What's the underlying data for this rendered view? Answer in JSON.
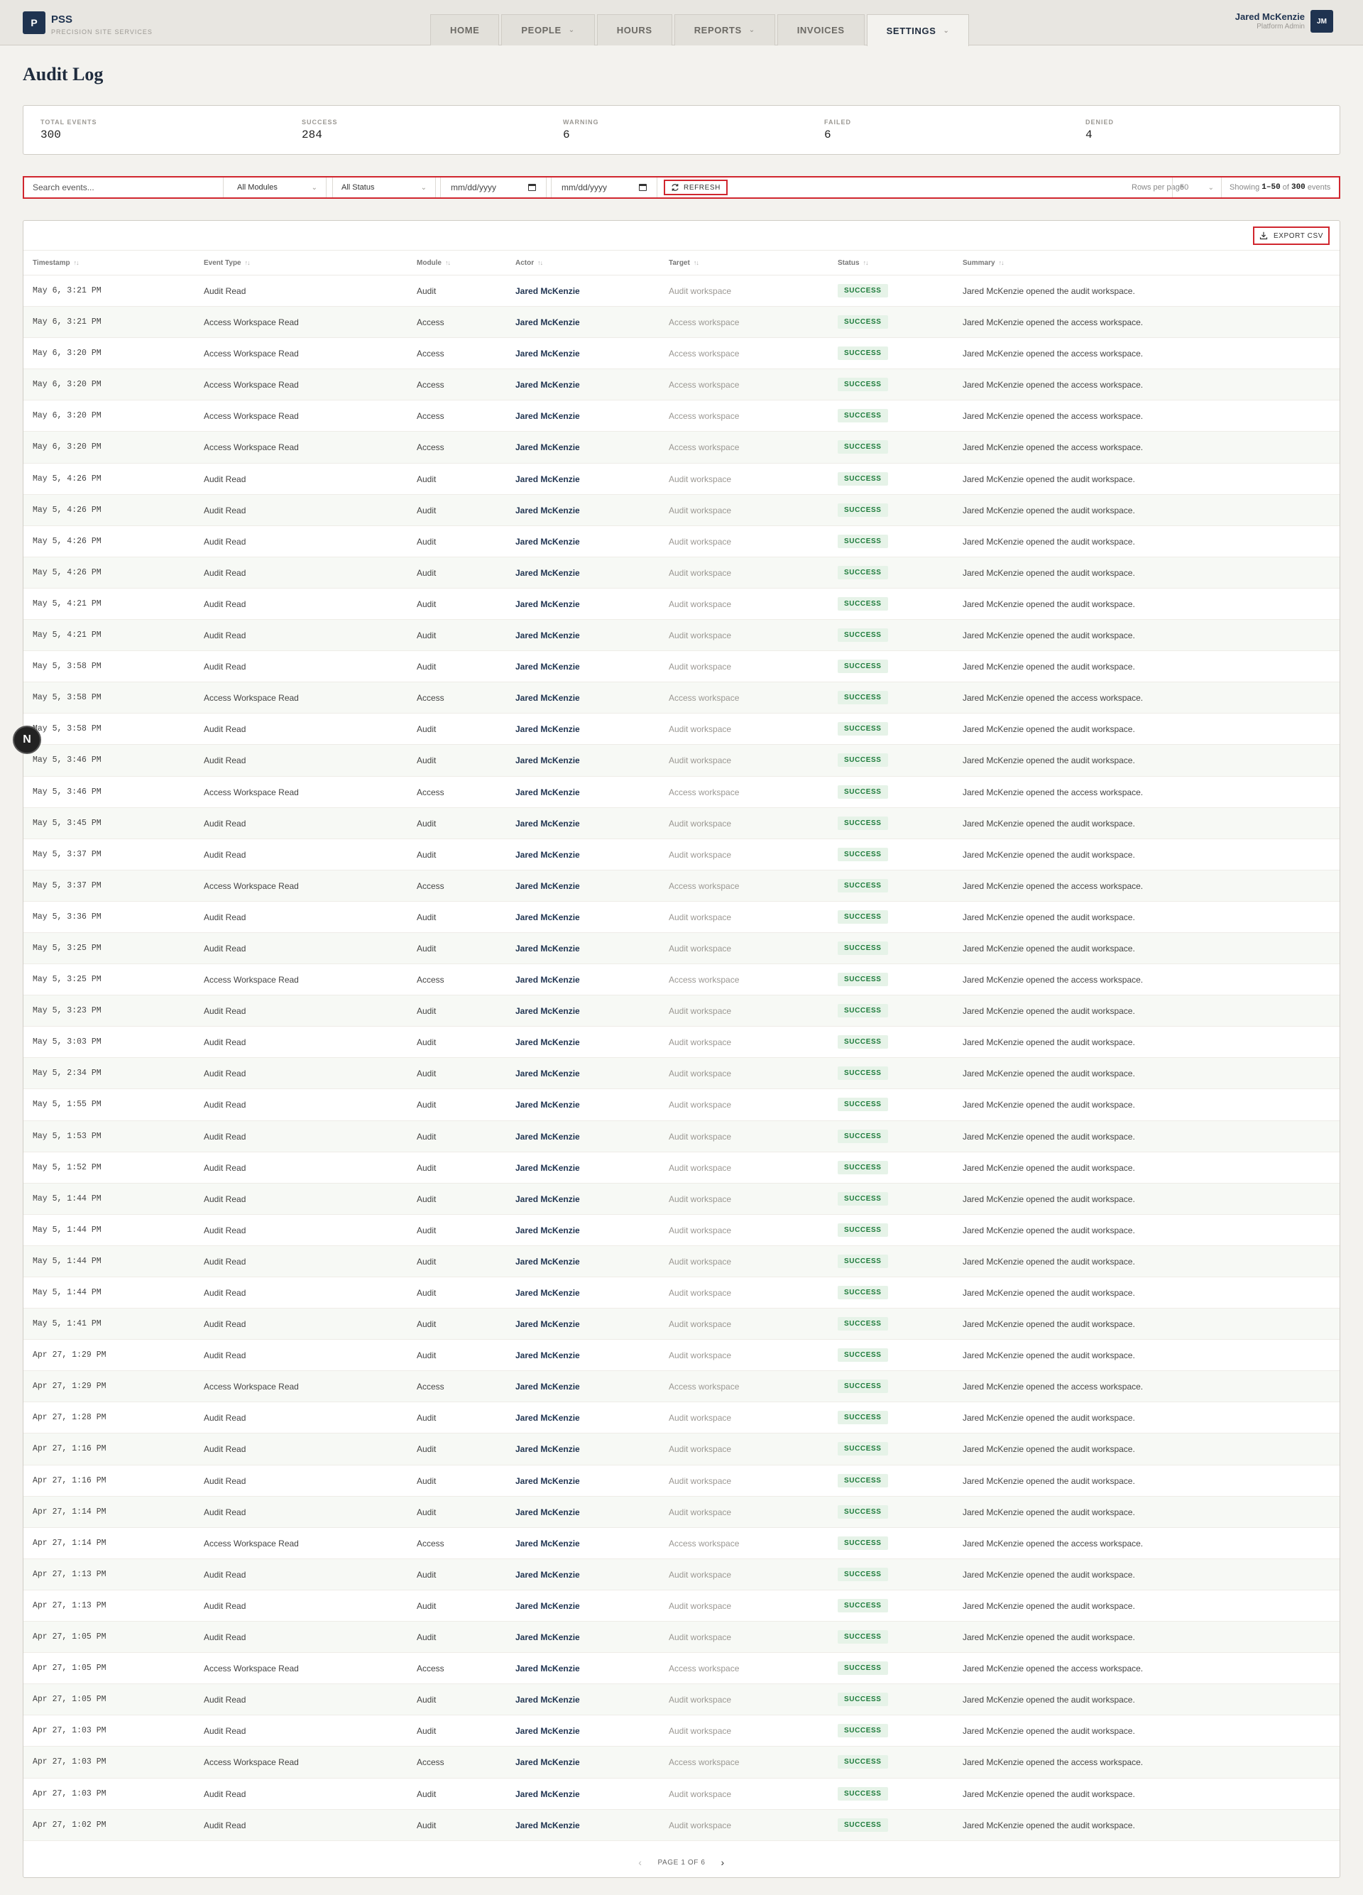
{
  "brand": {
    "logo": "P",
    "name": "PSS",
    "subtitle": "PRECISION SITE SERVICES"
  },
  "nav": {
    "tabs": [
      {
        "label": "HOME",
        "dropdown": false,
        "active": false
      },
      {
        "label": "PEOPLE",
        "dropdown": true,
        "active": false
      },
      {
        "label": "HOURS",
        "dropdown": false,
        "active": false
      },
      {
        "label": "REPORTS",
        "dropdown": true,
        "active": false
      },
      {
        "label": "INVOICES",
        "dropdown": false,
        "active": false
      },
      {
        "label": "SETTINGS",
        "dropdown": true,
        "active": true
      }
    ]
  },
  "user": {
    "name": "Jared McKenzie",
    "role": "Platform Admin",
    "initials": "JM"
  },
  "page": {
    "title": "Audit Log"
  },
  "summary": {
    "total": {
      "label": "TOTAL EVENTS",
      "value": "300"
    },
    "success": {
      "label": "SUCCESS",
      "value": "284"
    },
    "warning": {
      "label": "WARNING",
      "value": "6"
    },
    "failed": {
      "label": "FAILED",
      "value": "6"
    },
    "denied": {
      "label": "DENIED",
      "value": "4"
    }
  },
  "filters": {
    "search_placeholder": "Search events...",
    "module": "All Modules",
    "status": "All Status",
    "date_from": "mm/dd/yyyy",
    "date_to": "mm/dd/yyyy",
    "refresh_label": "REFRESH",
    "rows_label": "Rows per page",
    "rows_value": "50",
    "showing_prefix": "Showing",
    "showing_range": "1–50",
    "showing_of": "of",
    "showing_total": "300",
    "showing_suffix": "events"
  },
  "table": {
    "export_label": "EXPORT CSV",
    "columns": [
      "Timestamp",
      "Event Type",
      "Module",
      "Actor",
      "Target",
      "Status",
      "Summary"
    ],
    "rows": [
      [
        "May 6, 3:21 PM",
        "Audit Read",
        "Audit",
        "Jared McKenzie",
        "Audit workspace",
        "SUCCESS",
        "Jared McKenzie opened the audit workspace."
      ],
      [
        "May 6, 3:21 PM",
        "Access Workspace Read",
        "Access",
        "Jared McKenzie",
        "Access workspace",
        "SUCCESS",
        "Jared McKenzie opened the access workspace."
      ],
      [
        "May 6, 3:20 PM",
        "Access Workspace Read",
        "Access",
        "Jared McKenzie",
        "Access workspace",
        "SUCCESS",
        "Jared McKenzie opened the access workspace."
      ],
      [
        "May 6, 3:20 PM",
        "Access Workspace Read",
        "Access",
        "Jared McKenzie",
        "Access workspace",
        "SUCCESS",
        "Jared McKenzie opened the access workspace."
      ],
      [
        "May 6, 3:20 PM",
        "Access Workspace Read",
        "Access",
        "Jared McKenzie",
        "Access workspace",
        "SUCCESS",
        "Jared McKenzie opened the access workspace."
      ],
      [
        "May 6, 3:20 PM",
        "Access Workspace Read",
        "Access",
        "Jared McKenzie",
        "Access workspace",
        "SUCCESS",
        "Jared McKenzie opened the access workspace."
      ],
      [
        "May 5, 4:26 PM",
        "Audit Read",
        "Audit",
        "Jared McKenzie",
        "Audit workspace",
        "SUCCESS",
        "Jared McKenzie opened the audit workspace."
      ],
      [
        "May 5, 4:26 PM",
        "Audit Read",
        "Audit",
        "Jared McKenzie",
        "Audit workspace",
        "SUCCESS",
        "Jared McKenzie opened the audit workspace."
      ],
      [
        "May 5, 4:26 PM",
        "Audit Read",
        "Audit",
        "Jared McKenzie",
        "Audit workspace",
        "SUCCESS",
        "Jared McKenzie opened the audit workspace."
      ],
      [
        "May 5, 4:26 PM",
        "Audit Read",
        "Audit",
        "Jared McKenzie",
        "Audit workspace",
        "SUCCESS",
        "Jared McKenzie opened the audit workspace."
      ],
      [
        "May 5, 4:21 PM",
        "Audit Read",
        "Audit",
        "Jared McKenzie",
        "Audit workspace",
        "SUCCESS",
        "Jared McKenzie opened the audit workspace."
      ],
      [
        "May 5, 4:21 PM",
        "Audit Read",
        "Audit",
        "Jared McKenzie",
        "Audit workspace",
        "SUCCESS",
        "Jared McKenzie opened the audit workspace."
      ],
      [
        "May 5, 3:58 PM",
        "Audit Read",
        "Audit",
        "Jared McKenzie",
        "Audit workspace",
        "SUCCESS",
        "Jared McKenzie opened the audit workspace."
      ],
      [
        "May 5, 3:58 PM",
        "Access Workspace Read",
        "Access",
        "Jared McKenzie",
        "Access workspace",
        "SUCCESS",
        "Jared McKenzie opened the access workspace."
      ],
      [
        "May 5, 3:58 PM",
        "Audit Read",
        "Audit",
        "Jared McKenzie",
        "Audit workspace",
        "SUCCESS",
        "Jared McKenzie opened the audit workspace."
      ],
      [
        "May 5, 3:46 PM",
        "Audit Read",
        "Audit",
        "Jared McKenzie",
        "Audit workspace",
        "SUCCESS",
        "Jared McKenzie opened the audit workspace."
      ],
      [
        "May 5, 3:46 PM",
        "Access Workspace Read",
        "Access",
        "Jared McKenzie",
        "Access workspace",
        "SUCCESS",
        "Jared McKenzie opened the access workspace."
      ],
      [
        "May 5, 3:45 PM",
        "Audit Read",
        "Audit",
        "Jared McKenzie",
        "Audit workspace",
        "SUCCESS",
        "Jared McKenzie opened the audit workspace."
      ],
      [
        "May 5, 3:37 PM",
        "Audit Read",
        "Audit",
        "Jared McKenzie",
        "Audit workspace",
        "SUCCESS",
        "Jared McKenzie opened the audit workspace."
      ],
      [
        "May 5, 3:37 PM",
        "Access Workspace Read",
        "Access",
        "Jared McKenzie",
        "Access workspace",
        "SUCCESS",
        "Jared McKenzie opened the access workspace."
      ],
      [
        "May 5, 3:36 PM",
        "Audit Read",
        "Audit",
        "Jared McKenzie",
        "Audit workspace",
        "SUCCESS",
        "Jared McKenzie opened the audit workspace."
      ],
      [
        "May 5, 3:25 PM",
        "Audit Read",
        "Audit",
        "Jared McKenzie",
        "Audit workspace",
        "SUCCESS",
        "Jared McKenzie opened the audit workspace."
      ],
      [
        "May 5, 3:25 PM",
        "Access Workspace Read",
        "Access",
        "Jared McKenzie",
        "Access workspace",
        "SUCCESS",
        "Jared McKenzie opened the access workspace."
      ],
      [
        "May 5, 3:23 PM",
        "Audit Read",
        "Audit",
        "Jared McKenzie",
        "Audit workspace",
        "SUCCESS",
        "Jared McKenzie opened the audit workspace."
      ],
      [
        "May 5, 3:03 PM",
        "Audit Read",
        "Audit",
        "Jared McKenzie",
        "Audit workspace",
        "SUCCESS",
        "Jared McKenzie opened the audit workspace."
      ],
      [
        "May 5, 2:34 PM",
        "Audit Read",
        "Audit",
        "Jared McKenzie",
        "Audit workspace",
        "SUCCESS",
        "Jared McKenzie opened the audit workspace."
      ],
      [
        "May 5, 1:55 PM",
        "Audit Read",
        "Audit",
        "Jared McKenzie",
        "Audit workspace",
        "SUCCESS",
        "Jared McKenzie opened the audit workspace."
      ],
      [
        "May 5, 1:53 PM",
        "Audit Read",
        "Audit",
        "Jared McKenzie",
        "Audit workspace",
        "SUCCESS",
        "Jared McKenzie opened the audit workspace."
      ],
      [
        "May 5, 1:52 PM",
        "Audit Read",
        "Audit",
        "Jared McKenzie",
        "Audit workspace",
        "SUCCESS",
        "Jared McKenzie opened the audit workspace."
      ],
      [
        "May 5, 1:44 PM",
        "Audit Read",
        "Audit",
        "Jared McKenzie",
        "Audit workspace",
        "SUCCESS",
        "Jared McKenzie opened the audit workspace."
      ],
      [
        "May 5, 1:44 PM",
        "Audit Read",
        "Audit",
        "Jared McKenzie",
        "Audit workspace",
        "SUCCESS",
        "Jared McKenzie opened the audit workspace."
      ],
      [
        "May 5, 1:44 PM",
        "Audit Read",
        "Audit",
        "Jared McKenzie",
        "Audit workspace",
        "SUCCESS",
        "Jared McKenzie opened the audit workspace."
      ],
      [
        "May 5, 1:44 PM",
        "Audit Read",
        "Audit",
        "Jared McKenzie",
        "Audit workspace",
        "SUCCESS",
        "Jared McKenzie opened the audit workspace."
      ],
      [
        "May 5, 1:41 PM",
        "Audit Read",
        "Audit",
        "Jared McKenzie",
        "Audit workspace",
        "SUCCESS",
        "Jared McKenzie opened the audit workspace."
      ],
      [
        "Apr 27, 1:29 PM",
        "Audit Read",
        "Audit",
        "Jared McKenzie",
        "Audit workspace",
        "SUCCESS",
        "Jared McKenzie opened the audit workspace."
      ],
      [
        "Apr 27, 1:29 PM",
        "Access Workspace Read",
        "Access",
        "Jared McKenzie",
        "Access workspace",
        "SUCCESS",
        "Jared McKenzie opened the access workspace."
      ],
      [
        "Apr 27, 1:28 PM",
        "Audit Read",
        "Audit",
        "Jared McKenzie",
        "Audit workspace",
        "SUCCESS",
        "Jared McKenzie opened the audit workspace."
      ],
      [
        "Apr 27, 1:16 PM",
        "Audit Read",
        "Audit",
        "Jared McKenzie",
        "Audit workspace",
        "SUCCESS",
        "Jared McKenzie opened the audit workspace."
      ],
      [
        "Apr 27, 1:16 PM",
        "Audit Read",
        "Audit",
        "Jared McKenzie",
        "Audit workspace",
        "SUCCESS",
        "Jared McKenzie opened the audit workspace."
      ],
      [
        "Apr 27, 1:14 PM",
        "Audit Read",
        "Audit",
        "Jared McKenzie",
        "Audit workspace",
        "SUCCESS",
        "Jared McKenzie opened the audit workspace."
      ],
      [
        "Apr 27, 1:14 PM",
        "Access Workspace Read",
        "Access",
        "Jared McKenzie",
        "Access workspace",
        "SUCCESS",
        "Jared McKenzie opened the access workspace."
      ],
      [
        "Apr 27, 1:13 PM",
        "Audit Read",
        "Audit",
        "Jared McKenzie",
        "Audit workspace",
        "SUCCESS",
        "Jared McKenzie opened the audit workspace."
      ],
      [
        "Apr 27, 1:13 PM",
        "Audit Read",
        "Audit",
        "Jared McKenzie",
        "Audit workspace",
        "SUCCESS",
        "Jared McKenzie opened the audit workspace."
      ],
      [
        "Apr 27, 1:05 PM",
        "Audit Read",
        "Audit",
        "Jared McKenzie",
        "Audit workspace",
        "SUCCESS",
        "Jared McKenzie opened the audit workspace."
      ],
      [
        "Apr 27, 1:05 PM",
        "Access Workspace Read",
        "Access",
        "Jared McKenzie",
        "Access workspace",
        "SUCCESS",
        "Jared McKenzie opened the access workspace."
      ],
      [
        "Apr 27, 1:05 PM",
        "Audit Read",
        "Audit",
        "Jared McKenzie",
        "Audit workspace",
        "SUCCESS",
        "Jared McKenzie opened the audit workspace."
      ],
      [
        "Apr 27, 1:03 PM",
        "Audit Read",
        "Audit",
        "Jared McKenzie",
        "Audit workspace",
        "SUCCESS",
        "Jared McKenzie opened the audit workspace."
      ],
      [
        "Apr 27, 1:03 PM",
        "Access Workspace Read",
        "Access",
        "Jared McKenzie",
        "Access workspace",
        "SUCCESS",
        "Jared McKenzie opened the access workspace."
      ],
      [
        "Apr 27, 1:03 PM",
        "Audit Read",
        "Audit",
        "Jared McKenzie",
        "Audit workspace",
        "SUCCESS",
        "Jared McKenzie opened the audit workspace."
      ],
      [
        "Apr 27, 1:02 PM",
        "Audit Read",
        "Audit",
        "Jared McKenzie",
        "Audit workspace",
        "SUCCESS",
        "Jared McKenzie opened the audit workspace."
      ]
    ]
  },
  "pagination": {
    "label": "PAGE 1 OF 6",
    "prev_icon": "chevron-left-icon",
    "next_icon": "chevron-right-icon"
  },
  "floating_badge": {
    "label": "N"
  },
  "colors": {
    "navy": "#1f3350",
    "accent_red": "#d0262e",
    "success_bg": "#e6f3e8",
    "success_text": "#1c7a3a",
    "page_bg": "#f3f2ee"
  }
}
